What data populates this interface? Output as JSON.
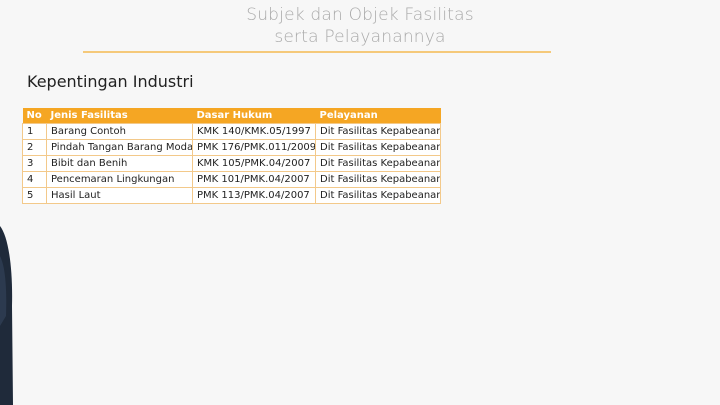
{
  "title": {
    "line1": "Subjek dan Objek Fasilitas",
    "line2": "serta Pelayanannya"
  },
  "section": {
    "heading": "Kepentingan Industri"
  },
  "table": {
    "headers": [
      "No",
      "Jenis Fasilitas",
      "Dasar Hukum",
      "Pelayanan"
    ],
    "rows": [
      [
        "1",
        "Barang Contoh",
        "KMK 140/KMK.05/1997",
        "Dit Fasilitas Kepabeanan"
      ],
      [
        "2",
        "Pindah Tangan Barang Modal",
        "PMK 176/PMK.011/2009",
        "Dit Fasilitas Kepabeanan"
      ],
      [
        "3",
        "Bibit dan Benih",
        "KMK 105/PMK.04/2007",
        "Dit Fasilitas Kepabeanan"
      ],
      [
        "4",
        "Pencemaran Lingkungan",
        "PMK 101/PMK.04/2007",
        "Dit Fasilitas Kepabeanan"
      ],
      [
        "5",
        "Hasil Laut",
        "PMK 113/PMK.04/2007",
        "Dit Fasilitas Kepabeanan"
      ]
    ]
  },
  "colors": {
    "accent": "#f5a623",
    "rule": "#f5c97a",
    "title_text": "#a9a9a9",
    "presenter_suit": "#1f2a3a"
  }
}
